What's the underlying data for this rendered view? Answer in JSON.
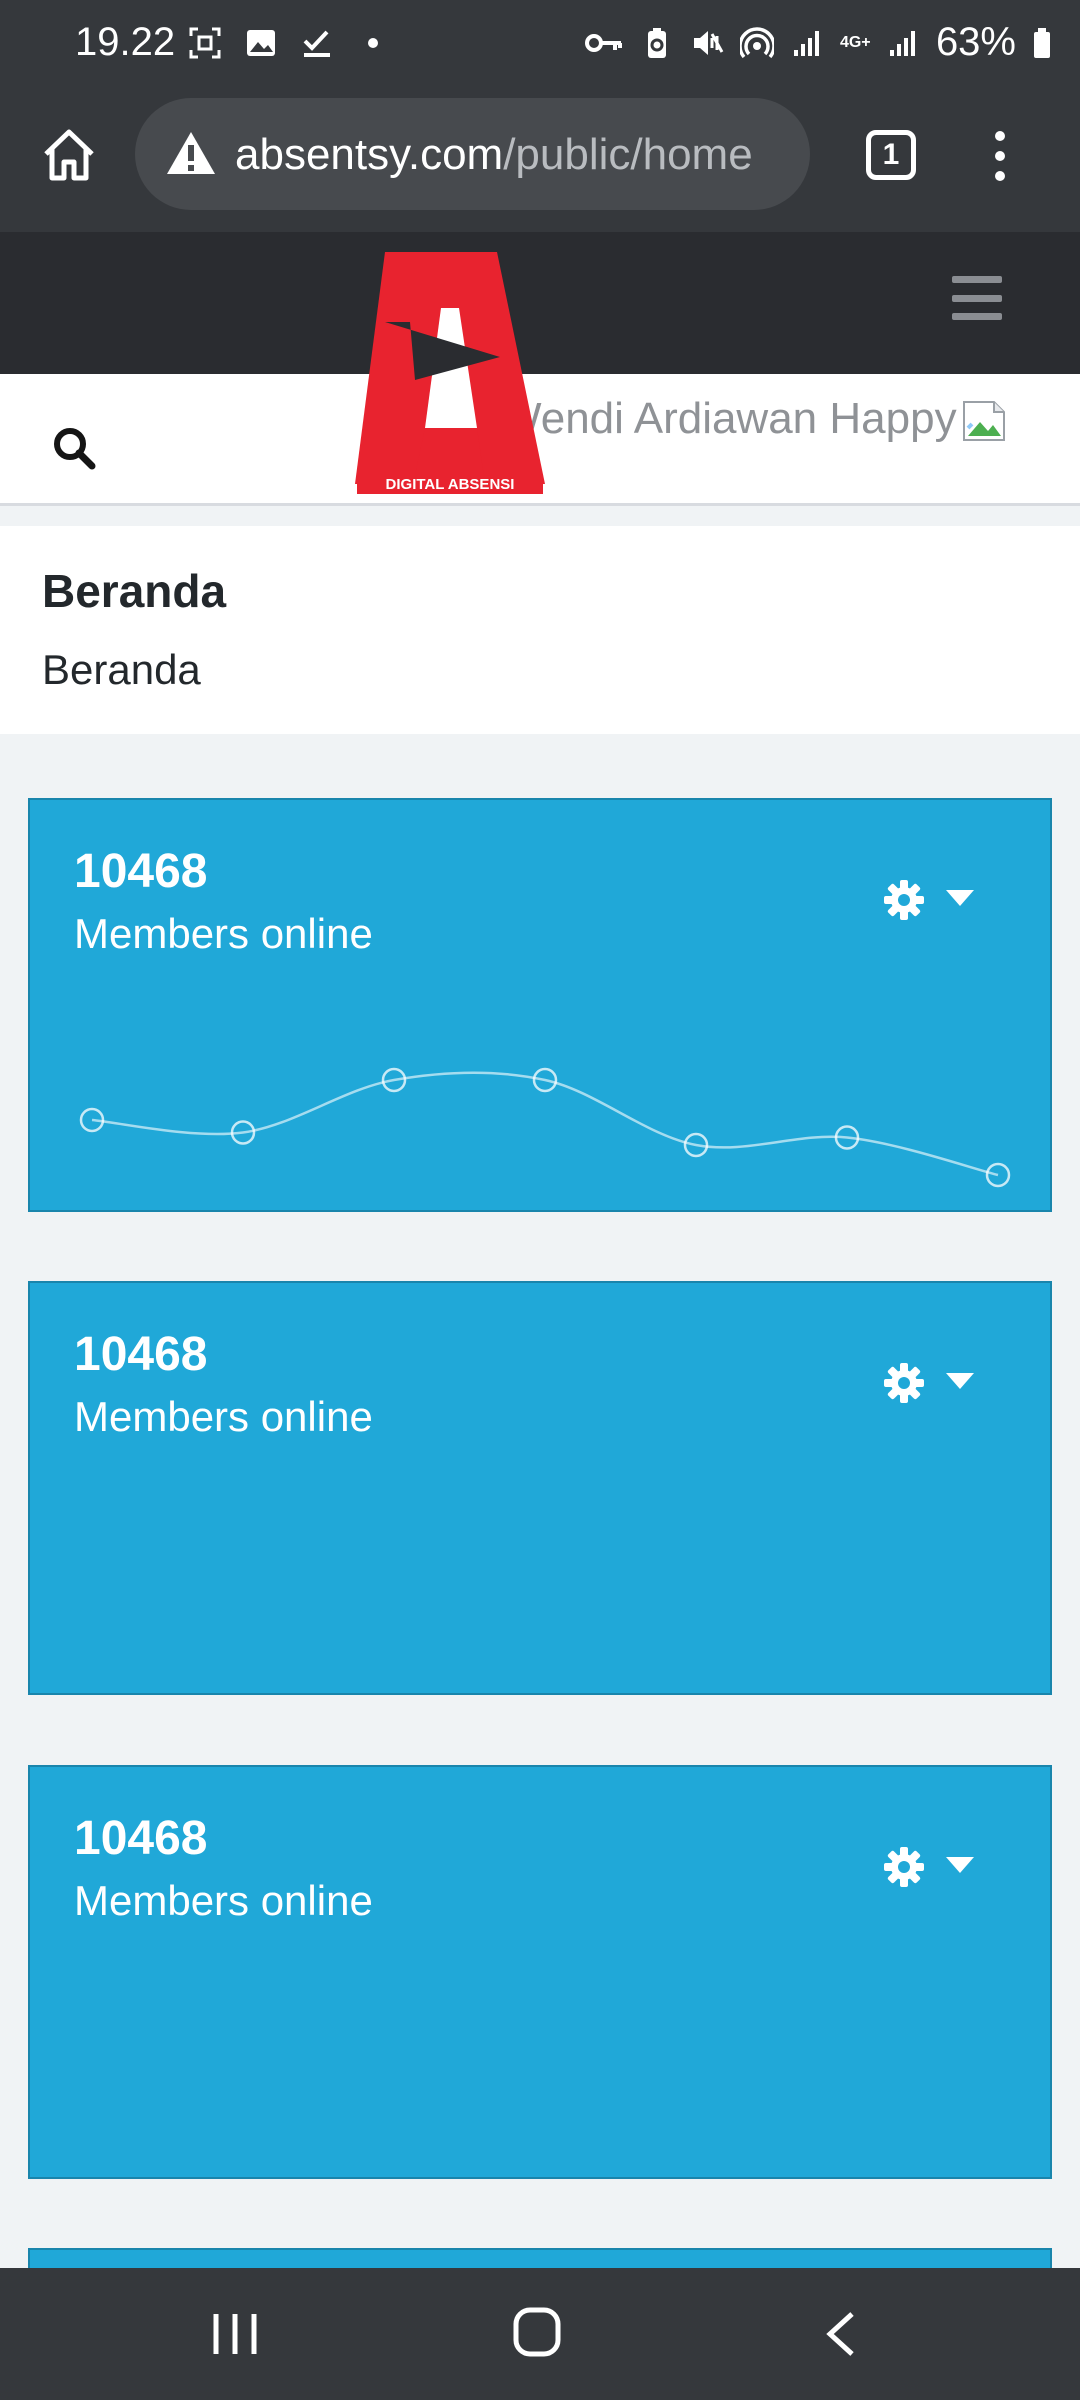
{
  "status_bar": {
    "time": "19.22",
    "battery": "63%",
    "network": "4G+"
  },
  "browser": {
    "url_domain": "absentsy.com",
    "url_path": "/public/home",
    "tab_count": "1"
  },
  "header": {
    "user_name": "Wendi Ardiawan Happy",
    "logo_text": "DIGITAL ABSENSI"
  },
  "page": {
    "title": "Beranda",
    "breadcrumb": "Beranda"
  },
  "cards": [
    {
      "value": "10468",
      "label": "Members online"
    },
    {
      "value": "10468",
      "label": "Members online"
    },
    {
      "value": "10468",
      "label": "Members online"
    }
  ],
  "chart_data": {
    "type": "line",
    "values": [
      62,
      57,
      78,
      78,
      52,
      55,
      40
    ]
  },
  "colors": {
    "card_bg": "#20a8d8",
    "header_bg": "#2a2c30",
    "logo_red": "#e8232f"
  }
}
